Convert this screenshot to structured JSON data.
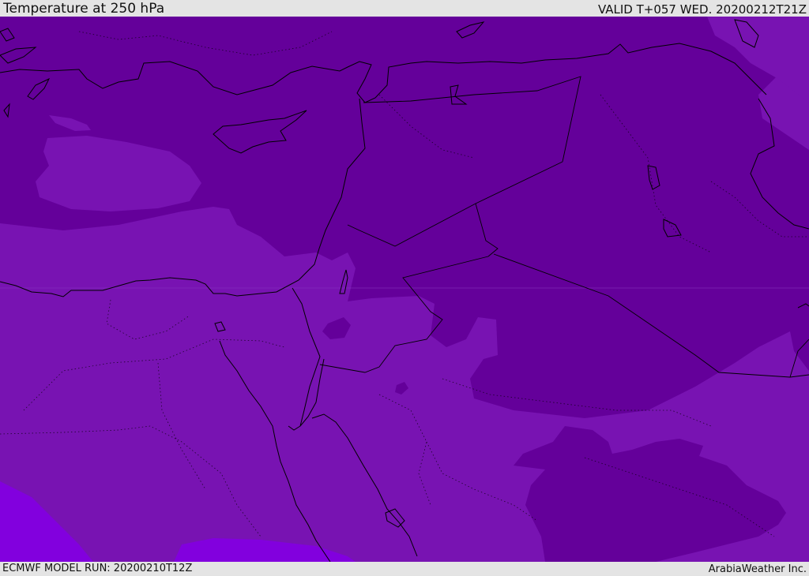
{
  "header": {
    "title": "Temperature at 250 hPa",
    "valid": "VALID T+057 WED. 20200212T21Z"
  },
  "footer": {
    "model_run": "ECMWF MODEL RUN: 20200210T12Z",
    "credit": "ArabiaWeather Inc."
  },
  "map": {
    "colors": {
      "mid_purple": "#7813b2",
      "dark_purple": "#64009a",
      "bright_violet": "#8200de",
      "coastline": "#000000"
    }
  }
}
